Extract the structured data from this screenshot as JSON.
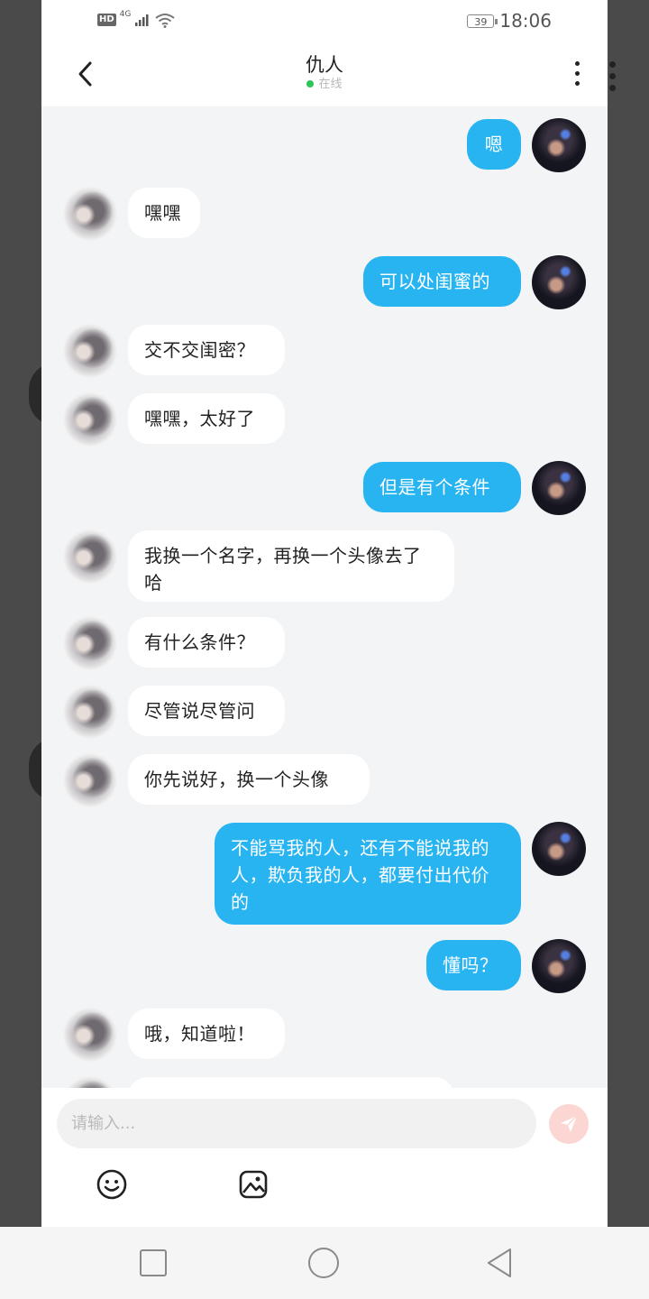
{
  "status_bar": {
    "hd_label": "HD",
    "network_label": "4G",
    "battery": "39",
    "time": "18:06",
    "icons": [
      "signal-icon",
      "wifi-icon",
      "battery-icon"
    ]
  },
  "header": {
    "title": "仇人",
    "presence": "在线",
    "presence_color": "#2ec55b",
    "icons": [
      "back-chevron-icon",
      "more-vertical-icon"
    ]
  },
  "colors": {
    "my_bubble": "#27b4f1",
    "other_bubble": "#ffffff",
    "background": "#f3f4f6",
    "send_button": "#fbd6d2"
  },
  "messages": [
    {
      "from": "me",
      "text": "嗯"
    },
    {
      "from": "other",
      "text": "嘿嘿"
    },
    {
      "from": "me",
      "text": "可以处闺蜜的"
    },
    {
      "from": "other",
      "text": "交不交闺密？"
    },
    {
      "from": "other",
      "text": "嘿嘿，太好了"
    },
    {
      "from": "me",
      "text": "但是有个条件"
    },
    {
      "from": "other",
      "text": "我换一个名字，再换一个头像去了哈"
    },
    {
      "from": "other",
      "text": "有什么条件？"
    },
    {
      "from": "other",
      "text": "尽管说尽管问"
    },
    {
      "from": "other",
      "text": "你先说好，换一个头像"
    },
    {
      "from": "me",
      "text": "不能骂我的人，还有不能说我的人，欺负我的人，都要付出代价的"
    },
    {
      "from": "me",
      "text": "懂吗？"
    },
    {
      "from": "other",
      "text": "哦，知道啦！"
    }
  ],
  "composer": {
    "placeholder": "请输入...",
    "value": "",
    "icons": [
      "send-icon",
      "emoji-icon",
      "image-icon"
    ]
  },
  "system_nav": {
    "icons": [
      "recent-apps-icon",
      "home-icon",
      "back-icon"
    ]
  }
}
